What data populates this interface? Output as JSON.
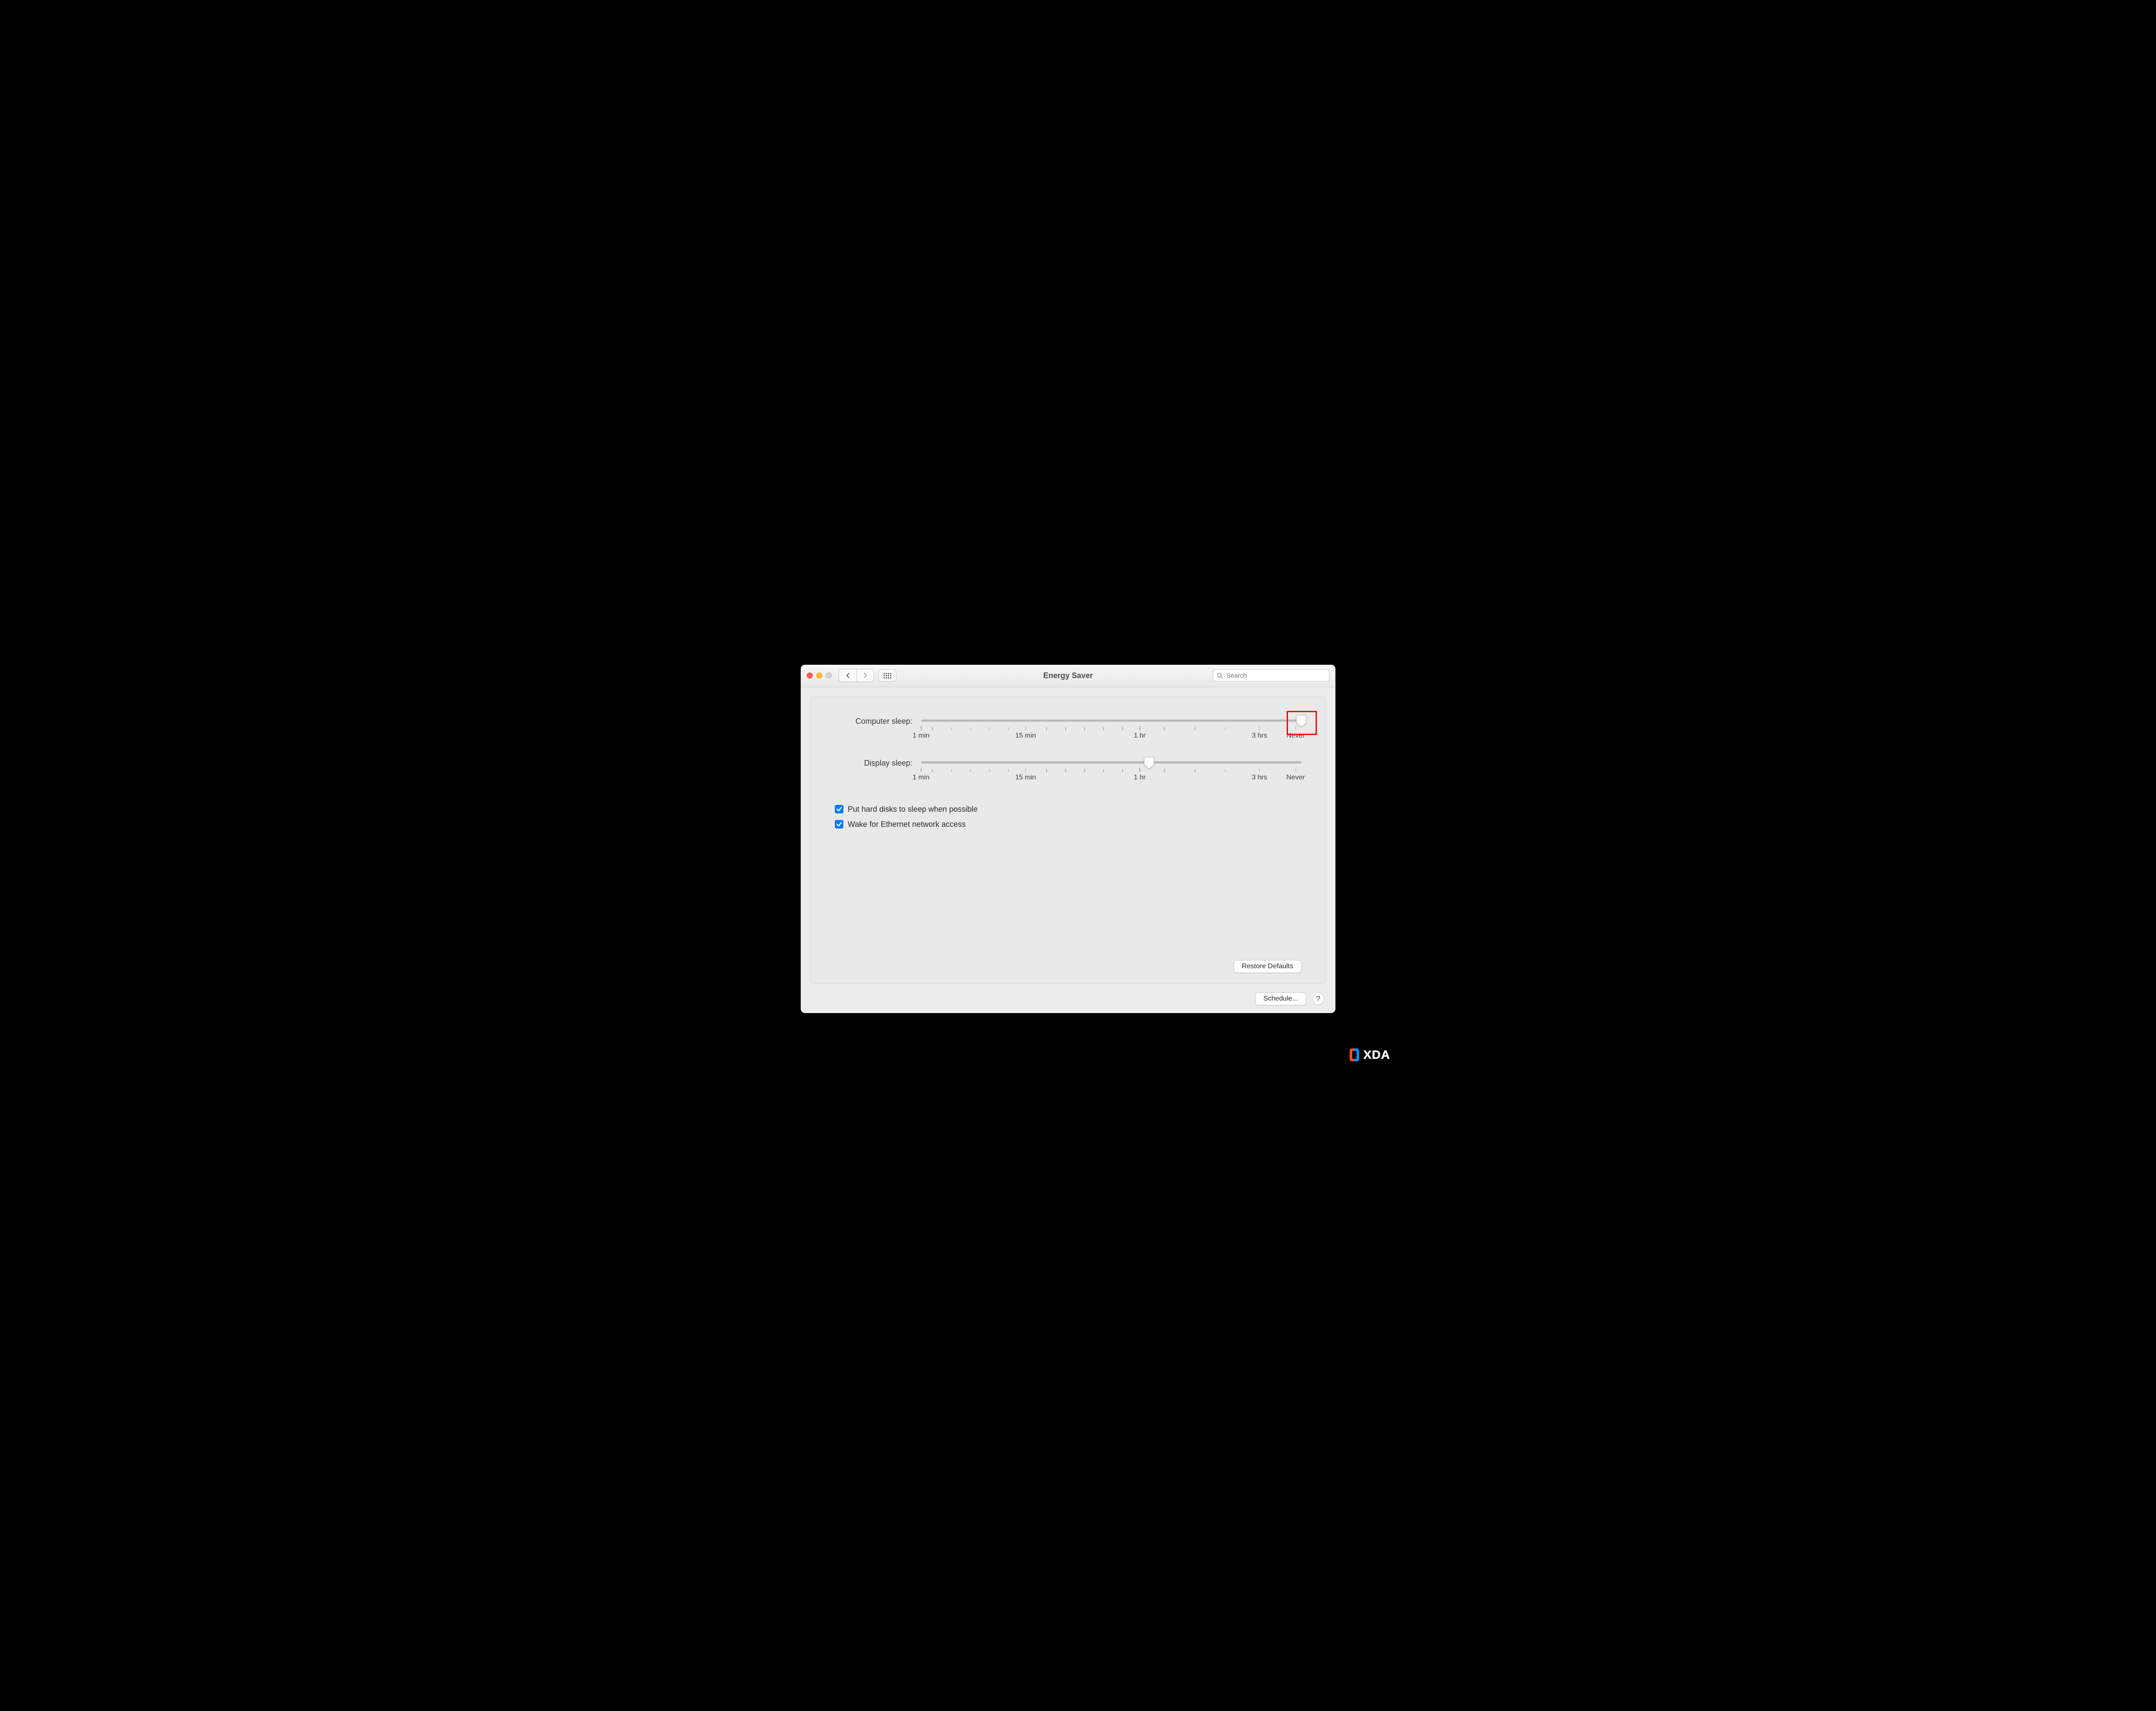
{
  "window": {
    "title": "Energy Saver"
  },
  "search": {
    "placeholder": "Search",
    "value": ""
  },
  "sliders": {
    "computer": {
      "label": "Computer sleep:",
      "value_percent": 100,
      "ticks": {
        "labels": [
          {
            "pct": 0,
            "text": "1 min"
          },
          {
            "pct": 27.5,
            "text": "15 min"
          },
          {
            "pct": 57.5,
            "text": "1 hr"
          },
          {
            "pct": 89,
            "text": "3 hrs"
          },
          {
            "pct": 98.5,
            "text": "Never"
          }
        ]
      },
      "highlighted": true
    },
    "display": {
      "label": "Display sleep:",
      "value_percent": 60,
      "ticks": {
        "labels": [
          {
            "pct": 0,
            "text": "1 min"
          },
          {
            "pct": 27.5,
            "text": "15 min"
          },
          {
            "pct": 57.5,
            "text": "1 hr"
          },
          {
            "pct": 89,
            "text": "3 hrs"
          },
          {
            "pct": 98.5,
            "text": "Never"
          }
        ]
      }
    }
  },
  "checkboxes": {
    "hd_sleep": {
      "label": "Put hard disks to sleep when possible",
      "checked": true
    },
    "wake_net": {
      "label": "Wake for Ethernet network access",
      "checked": true
    }
  },
  "buttons": {
    "restore_defaults": "Restore Defaults",
    "schedule": "Schedule...",
    "help": "?"
  },
  "watermark": {
    "text": "XDA"
  }
}
